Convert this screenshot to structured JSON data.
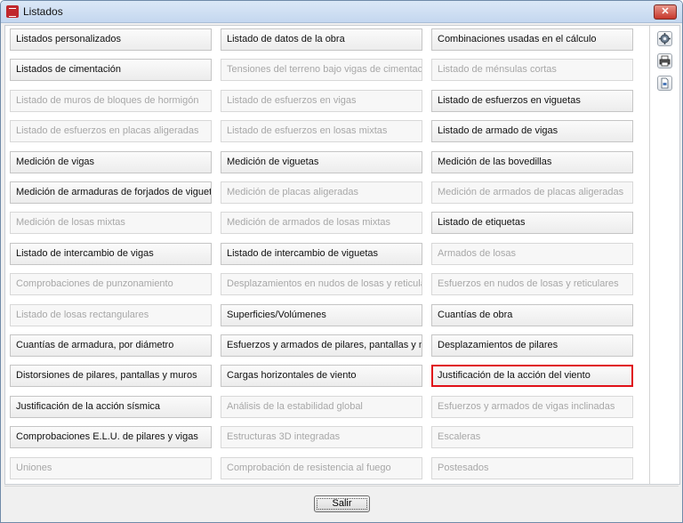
{
  "window": {
    "title": "Listados",
    "close_label": "✕"
  },
  "rows": [
    [
      {
        "label": "Listados personalizados",
        "enabled": true
      },
      {
        "label": "Listado de datos de la obra",
        "enabled": true
      },
      {
        "label": "Combinaciones usadas en el cálculo",
        "enabled": true
      }
    ],
    [
      {
        "label": "Listados de cimentación",
        "enabled": true
      },
      {
        "label": "Tensiones del terreno bajo vigas de cimentación",
        "enabled": false
      },
      {
        "label": "Listado de ménsulas cortas",
        "enabled": false
      }
    ],
    [
      {
        "label": "Listado de muros de bloques de hormigón",
        "enabled": false
      },
      {
        "label": "Listado de esfuerzos en vigas",
        "enabled": false
      },
      {
        "label": "Listado de esfuerzos en viguetas",
        "enabled": true
      }
    ],
    [
      {
        "label": "Listado de esfuerzos en placas aligeradas",
        "enabled": false
      },
      {
        "label": "Listado de esfuerzos en losas mixtas",
        "enabled": false
      },
      {
        "label": "Listado de armado de vigas",
        "enabled": true
      }
    ],
    [
      {
        "label": "Medición de vigas",
        "enabled": true
      },
      {
        "label": "Medición de viguetas",
        "enabled": true
      },
      {
        "label": "Medición de las bovedillas",
        "enabled": true
      }
    ],
    [
      {
        "label": "Medición de armaduras de forjados de viguetas",
        "enabled": true
      },
      {
        "label": "Medición de placas aligeradas",
        "enabled": false
      },
      {
        "label": "Medición de armados de placas aligeradas",
        "enabled": false
      }
    ],
    [
      {
        "label": "Medición de losas mixtas",
        "enabled": false
      },
      {
        "label": "Medición de armados de losas mixtas",
        "enabled": false
      },
      {
        "label": "Listado de etiquetas",
        "enabled": true
      }
    ],
    [
      {
        "label": "Listado de intercambio de vigas",
        "enabled": true
      },
      {
        "label": "Listado de intercambio de viguetas",
        "enabled": true
      },
      {
        "label": "Armados de losas",
        "enabled": false
      }
    ],
    [
      {
        "label": "Comprobaciones de punzonamiento",
        "enabled": false
      },
      {
        "label": "Desplazamientos en nudos de losas y reticulares",
        "enabled": false
      },
      {
        "label": "Esfuerzos en nudos de losas y reticulares",
        "enabled": false
      }
    ],
    [
      {
        "label": "Listado de losas rectangulares",
        "enabled": false
      },
      {
        "label": "Superficies/Volúmenes",
        "enabled": true
      },
      {
        "label": "Cuantías de obra",
        "enabled": true
      }
    ],
    [
      {
        "label": "Cuantías de armadura, por diámetro",
        "enabled": true
      },
      {
        "label": "Esfuerzos y armados de pilares, pantallas y muros",
        "enabled": true
      },
      {
        "label": "Desplazamientos de pilares",
        "enabled": true
      }
    ],
    [
      {
        "label": "Distorsiones de pilares, pantallas y muros",
        "enabled": true
      },
      {
        "label": "Cargas horizontales de viento",
        "enabled": true
      },
      {
        "label": "Justificación de la acción del viento",
        "enabled": true,
        "selected": true
      }
    ],
    [
      {
        "label": "Justificación de la acción sísmica",
        "enabled": true
      },
      {
        "label": "Análisis de la estabilidad global",
        "enabled": false
      },
      {
        "label": "Esfuerzos y armados de vigas inclinadas",
        "enabled": false
      }
    ],
    [
      {
        "label": "Comprobaciones E.L.U. de pilares y vigas",
        "enabled": true
      },
      {
        "label": "Estructuras 3D integradas",
        "enabled": false
      },
      {
        "label": "Escaleras",
        "enabled": false
      }
    ],
    [
      {
        "label": "Uniones",
        "enabled": false
      },
      {
        "label": "Comprobación de resistencia al fuego",
        "enabled": false
      },
      {
        "label": "Postesados",
        "enabled": false
      }
    ]
  ],
  "tools": [
    {
      "name": "settings-gear-icon"
    },
    {
      "name": "printer-icon"
    },
    {
      "name": "document-export-icon"
    }
  ],
  "footer": {
    "exit_label": "Salir"
  },
  "colors": {
    "selection_border": "#e01018",
    "disabled_text": "#a7a7a7"
  }
}
